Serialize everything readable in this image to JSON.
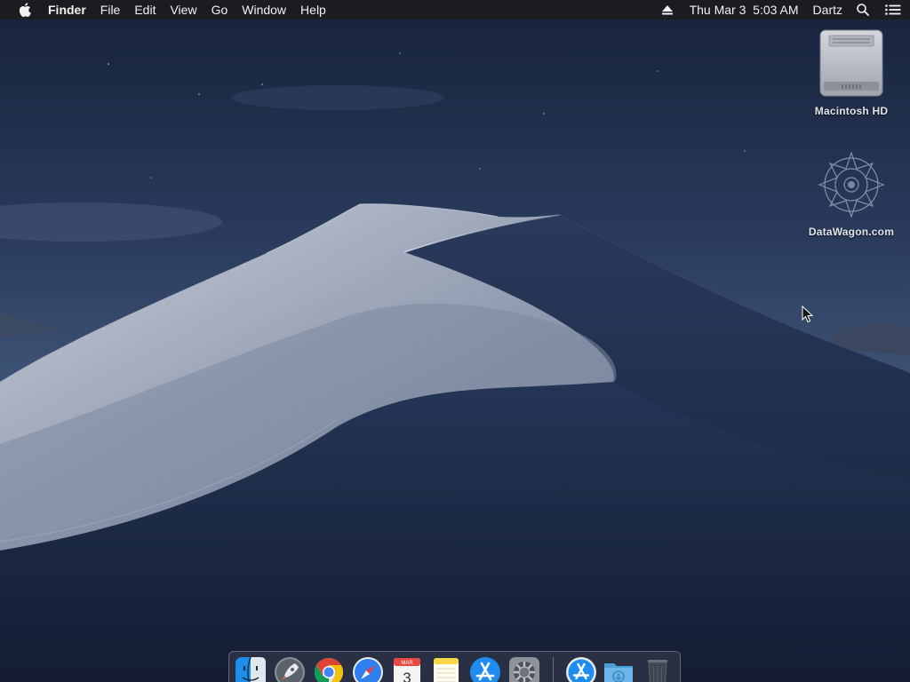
{
  "menubar": {
    "apple_icon": "apple-icon",
    "app_name": "Finder",
    "menus": [
      "File",
      "Edit",
      "View",
      "Go",
      "Window",
      "Help"
    ],
    "status": {
      "eject_icon": "eject-icon",
      "datetime": "Thu Mar 3  5:03 AM",
      "user": "Dartz",
      "spotlight_icon": "search-icon",
      "notification_icon": "notification-center-icon"
    }
  },
  "desktop": {
    "icons": [
      {
        "label": "Macintosh HD",
        "icon": "hard-drive-icon"
      },
      {
        "label": "DataWagon.com",
        "icon": "network-volume-icon"
      }
    ]
  },
  "dock": {
    "items": [
      {
        "name": "Finder",
        "icon": "finder-icon"
      },
      {
        "name": "Launchpad",
        "icon": "launchpad-icon"
      },
      {
        "name": "Google Chrome",
        "icon": "chrome-icon"
      },
      {
        "name": "Safari",
        "icon": "safari-icon"
      },
      {
        "name": "Calendar",
        "icon": "calendar-icon",
        "month": "MAR",
        "day": "3"
      },
      {
        "name": "Notes",
        "icon": "notes-icon"
      },
      {
        "name": "App Store",
        "icon": "app-store-icon"
      },
      {
        "name": "System Preferences",
        "icon": "system-preferences-icon"
      },
      {
        "name": "Applications",
        "icon": "applications-stack-icon"
      },
      {
        "name": "Downloads",
        "icon": "downloads-folder-icon"
      },
      {
        "name": "Trash",
        "icon": "trash-icon"
      }
    ]
  },
  "colors": {
    "menubar_bg": "#1c1c20",
    "sky_top": "#1a2540",
    "sky_bottom": "#3a4e6e",
    "dune_light": "#b6bfcf",
    "dune_shadow": "#1e2b48"
  }
}
